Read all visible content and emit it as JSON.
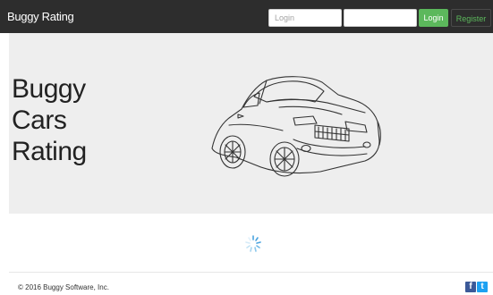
{
  "navbar": {
    "brand": "Buggy Rating",
    "login_placeholder": "Login",
    "password_value": "",
    "login_button": "Login",
    "register_button": "Register"
  },
  "hero": {
    "title_lines": [
      "Buggy",
      "Cars",
      "Rating"
    ]
  },
  "footer": {
    "copyright": "© 2016 Buggy Software, Inc.",
    "social": {
      "facebook": "f",
      "twitter": "t"
    }
  },
  "colors": {
    "navbar_bg": "#2d2d2d",
    "accent_green": "#5cb85c",
    "jumbotron_bg": "#eeeeee",
    "facebook_blue": "#3b5998",
    "twitter_blue": "#1da1f2"
  },
  "icons": [
    "car-illustration",
    "loading-spinner-icon",
    "facebook-icon",
    "twitter-icon"
  ]
}
